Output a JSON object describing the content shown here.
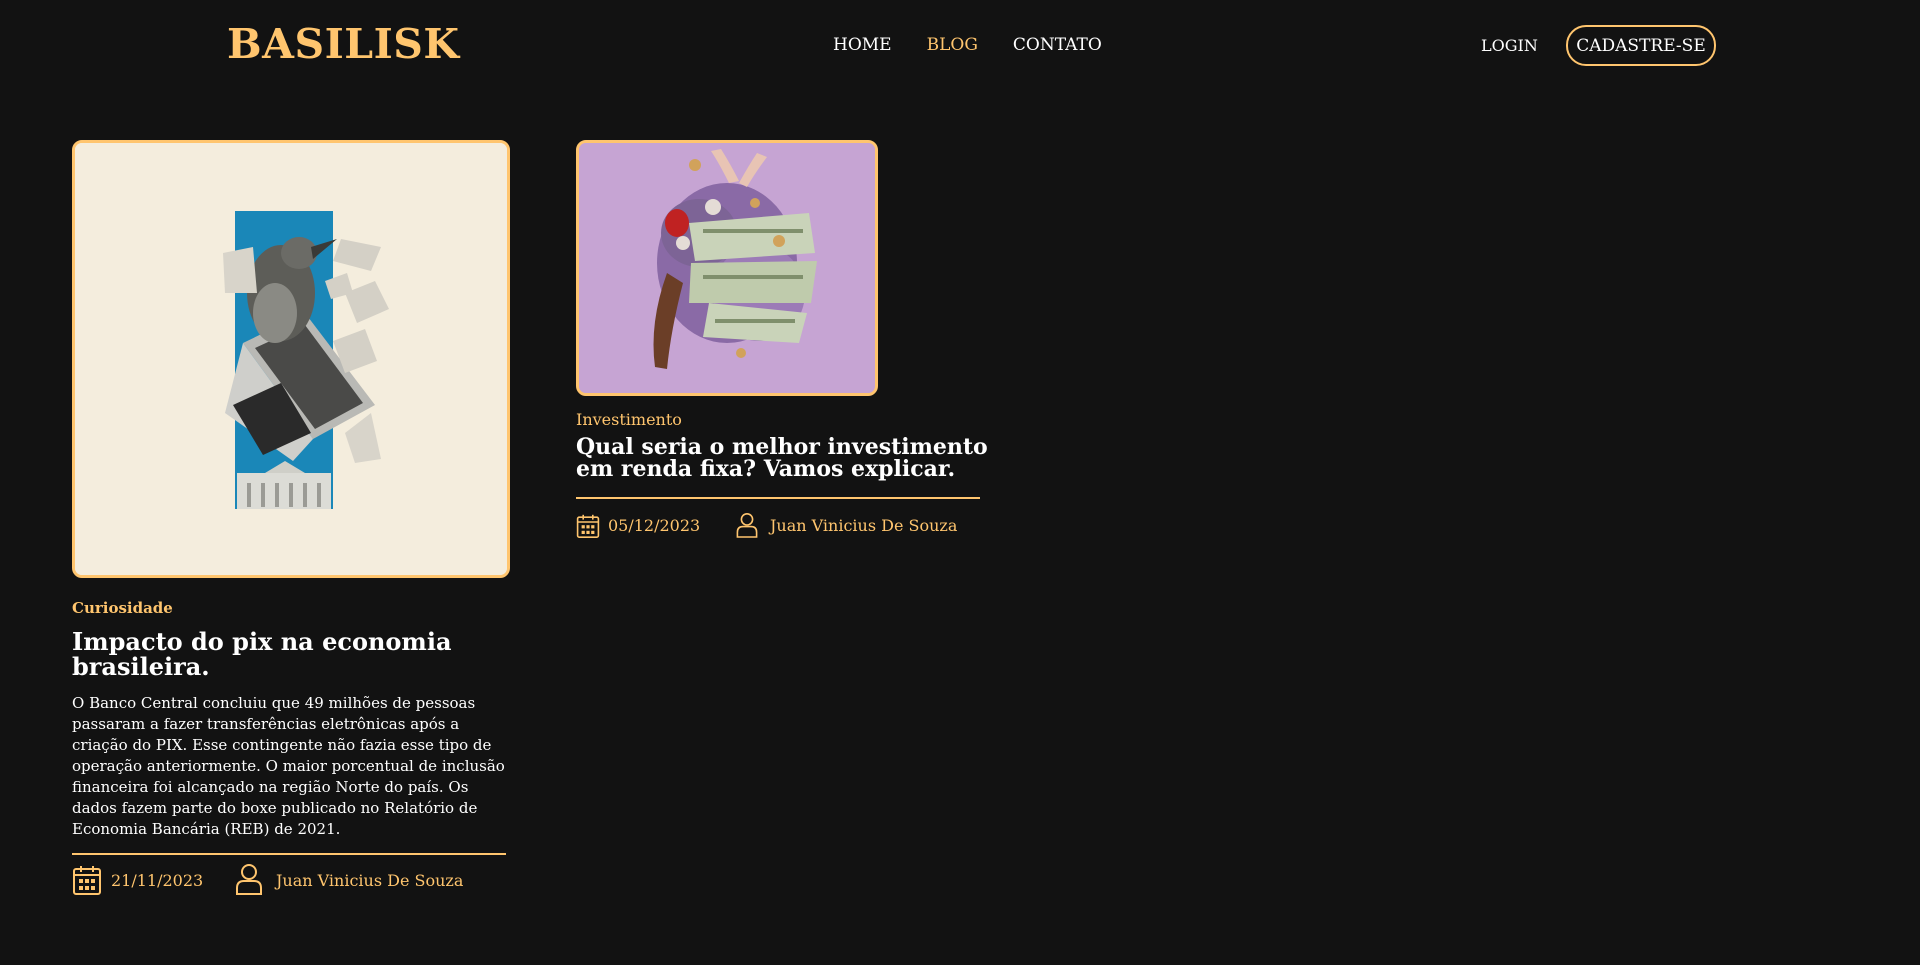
{
  "header": {
    "logo": "BASILISK",
    "nav": [
      {
        "label": "HOME"
      },
      {
        "label": "BLOG"
      },
      {
        "label": "CONTATO"
      }
    ],
    "login_label": "LOGIN",
    "signup_label": "CADASTRE-SE"
  },
  "colors": {
    "accent": "#ffc56e",
    "background": "#121212",
    "text": "#ffffff"
  },
  "posts": [
    {
      "image": "laptop-bird-collage",
      "category": "Curiosidade",
      "title": "Impacto do pix na economia brasileira.",
      "excerpt": "O Banco Central concluiu que 49 milhões de pessoas passaram a fazer transferências eletrônicas após a criação do PIX. Esse contingente não fazia esse tipo de operação anteriormente. O maior porcentual de inclusão financeira foi alcançado na região Norte do país. Os dados fazem parte do boxe publicado no Relatório de Economia Bancária (REB) de 2021.",
      "date": "21/11/2023",
      "author": "Juan Vinicius De Souza",
      "date_icon": "calendar-icon",
      "author_icon": "user-icon"
    },
    {
      "image": "money-hands-collage",
      "category": "Investimento",
      "title": "Qual seria o melhor investimento em renda fixa? Vamos explicar.",
      "date": "05/12/2023",
      "author": "Juan Vinicius De Souza",
      "date_icon": "calendar-icon",
      "author_icon": "user-icon"
    }
  ]
}
